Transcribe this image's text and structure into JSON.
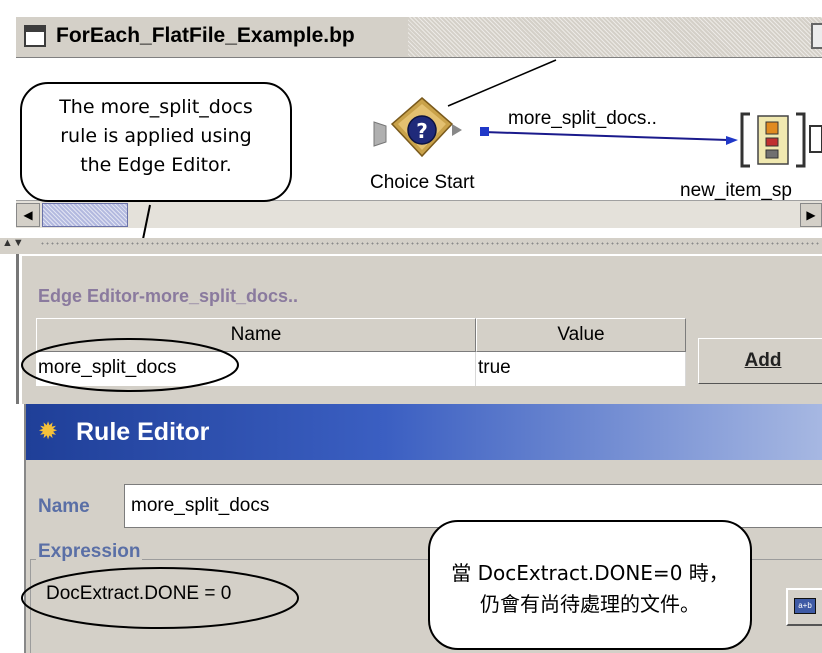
{
  "process_window": {
    "title": "ForEach_FlatFile_Example.bp",
    "nodes": {
      "choice_start": "Choice Start",
      "new_item": "new_item_sp"
    },
    "edge_label": "more_split_docs.."
  },
  "splitter": {
    "arrows": "▲▼"
  },
  "edge_editor": {
    "title": "Edge Editor-more_split_docs..",
    "columns": [
      "Name",
      "Value"
    ],
    "rows": [
      {
        "name": "more_split_docs",
        "value": "true"
      }
    ],
    "add_button": "Add"
  },
  "rule_editor": {
    "title": "Rule Editor",
    "name_label": "Name",
    "name_value": "more_split_docs",
    "expression_label": "Expression",
    "expression_value": "DocExtract.DONE = 0"
  },
  "annotations": {
    "edge_note": [
      "The more_split_docs",
      "rule is applied using",
      "the Edge Editor."
    ],
    "expr_note": [
      "當 DocExtract.DONE=0 時，",
      "仍會有尚待處理的文件。"
    ]
  },
  "colors": {
    "rule_titlebar_start": "#1f3f98",
    "rule_titlebar_end": "#a7b8e2",
    "label_blue": "#5a6fa6",
    "window_bg": "#d4d0c8"
  }
}
